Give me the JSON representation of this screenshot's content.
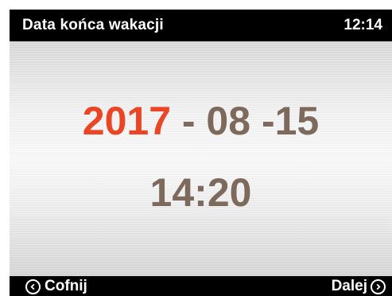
{
  "header": {
    "title": "Data końca wakacji",
    "clock": "12:14"
  },
  "date": {
    "year": "2017",
    "rest": " - 08 -15"
  },
  "time": {
    "value": "14:20"
  },
  "footer": {
    "back_label": "Cofnij",
    "next_label": "Dalej",
    "back_icon": "chevron-left-circle",
    "next_icon": "chevron-right-circle"
  },
  "colors": {
    "selected": "#ec4526",
    "normal": "#7d6a5d",
    "bar": "#000000"
  }
}
